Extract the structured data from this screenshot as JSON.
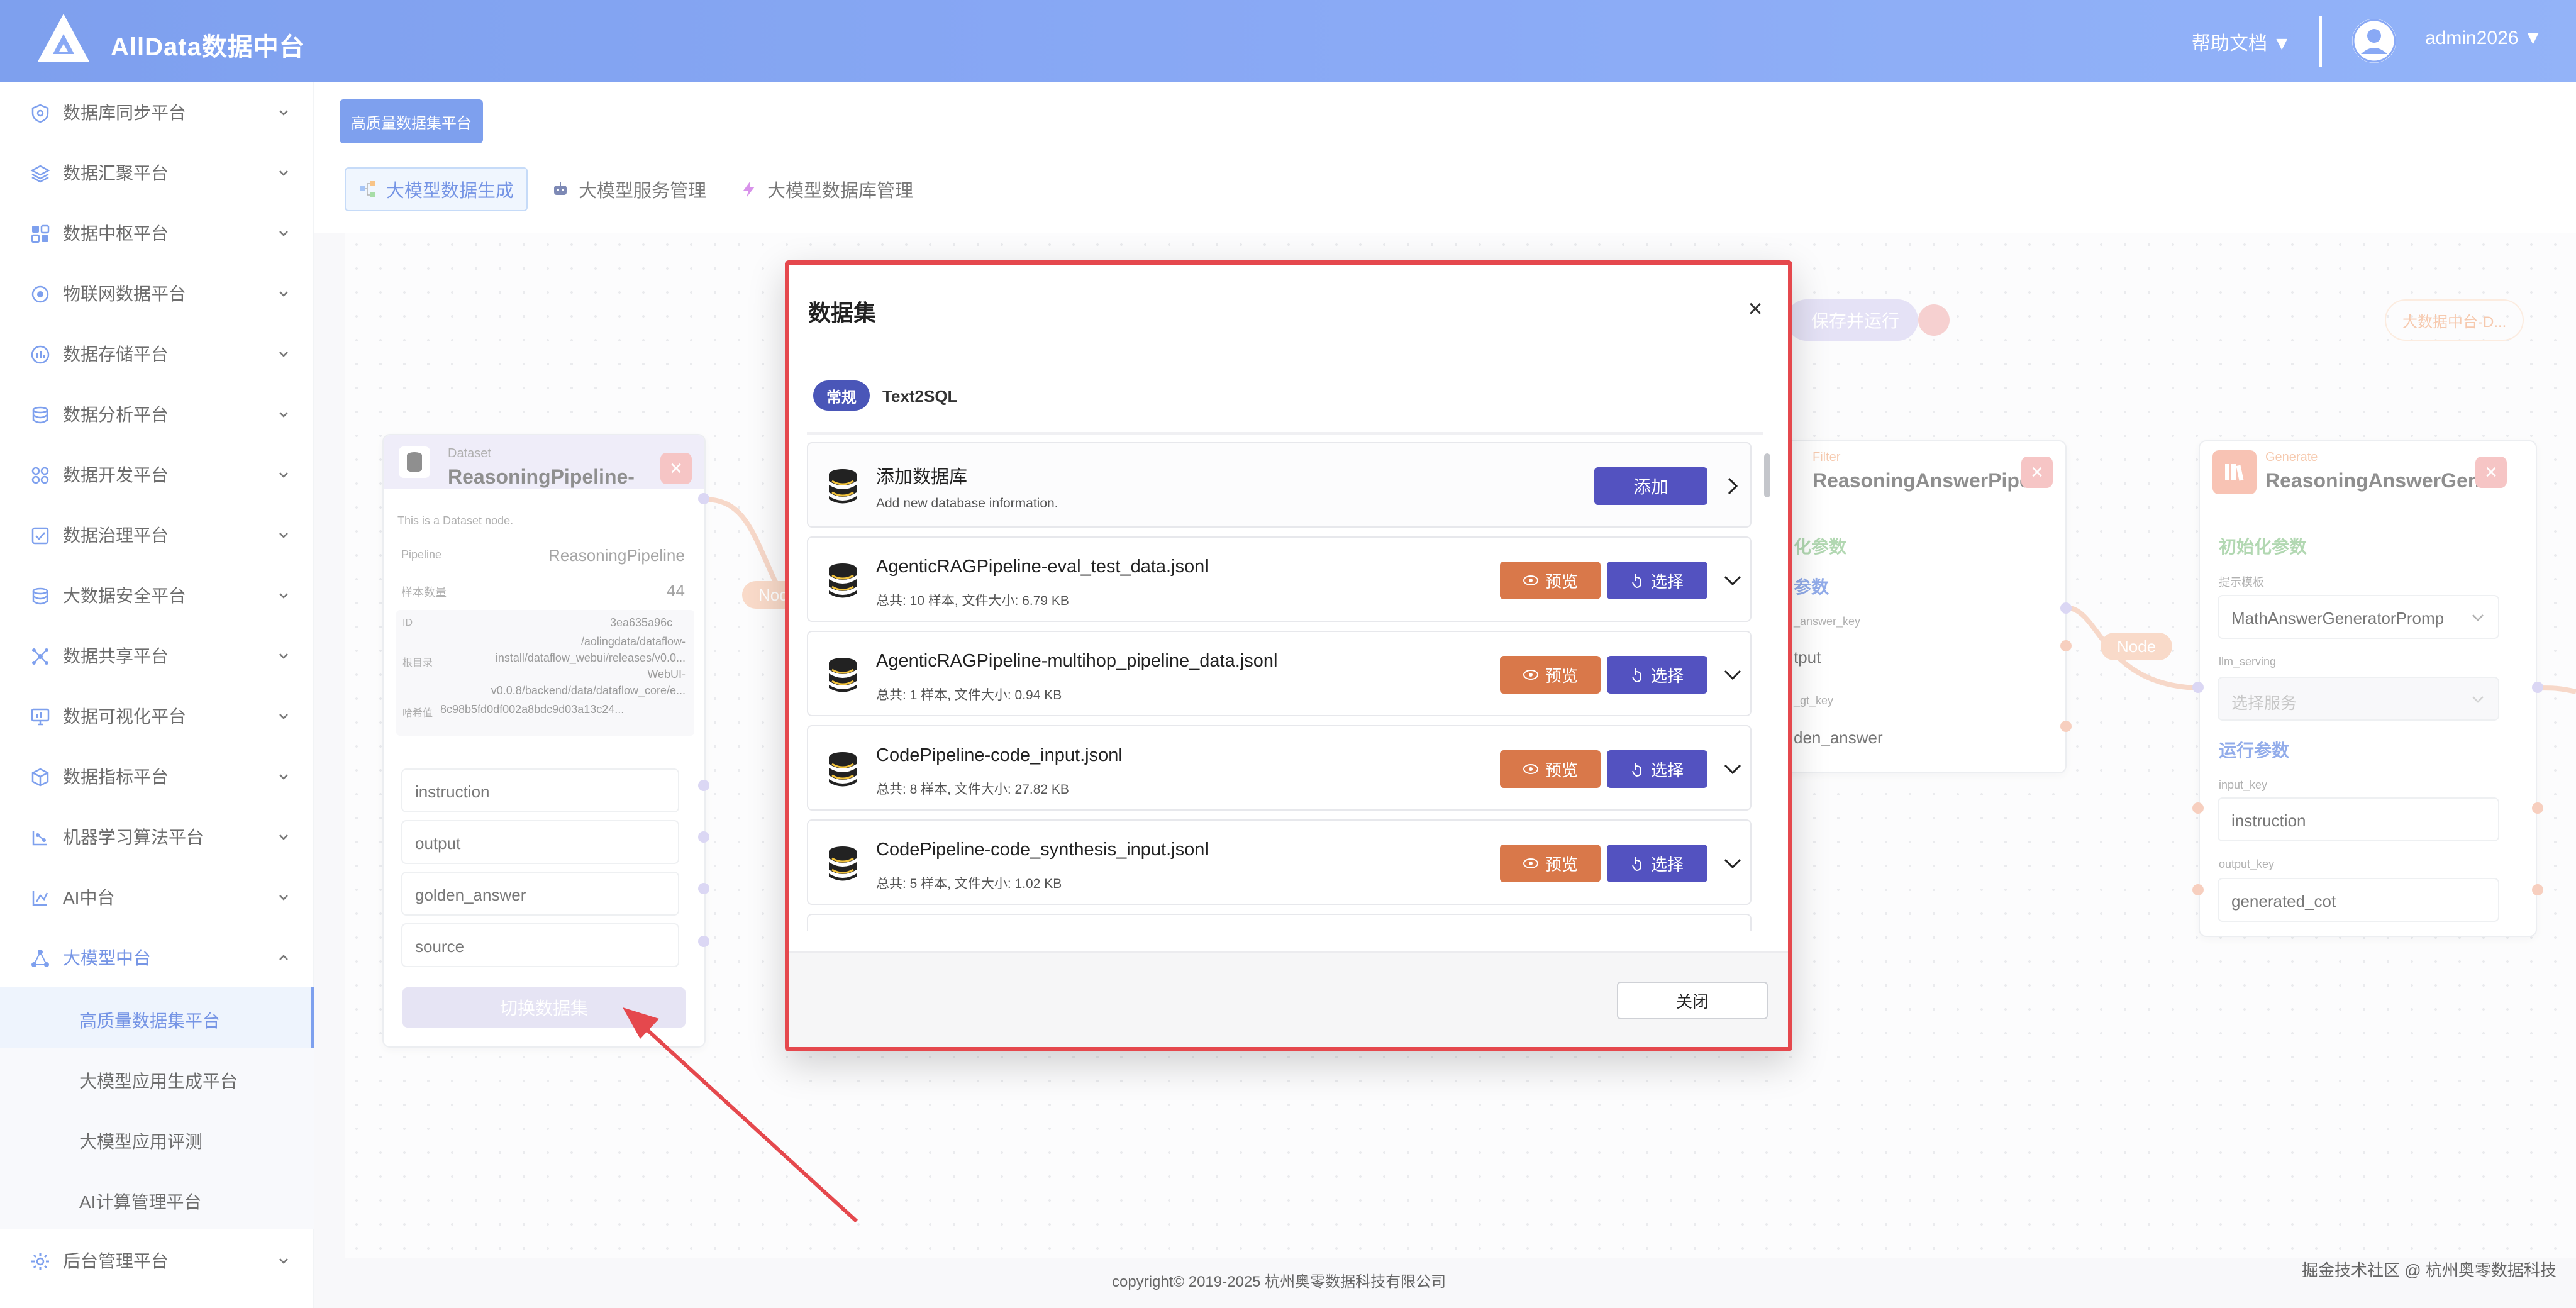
{
  "app": {
    "title": "AllData数据中台"
  },
  "topbar": {
    "help_label": "帮助文档 ▼",
    "user_label": "admin2026 ▼"
  },
  "sidebar": {
    "items": [
      {
        "label": "数据库同步平台"
      },
      {
        "label": "数据汇聚平台"
      },
      {
        "label": "数据中枢平台"
      },
      {
        "label": "物联网数据平台"
      },
      {
        "label": "数据存储平台"
      },
      {
        "label": "数据分析平台"
      },
      {
        "label": "数据开发平台"
      },
      {
        "label": "数据治理平台"
      },
      {
        "label": "大数据安全平台"
      },
      {
        "label": "数据共享平台"
      },
      {
        "label": "数据可视化平台"
      },
      {
        "label": "数据指标平台"
      },
      {
        "label": "机器学习算法平台"
      },
      {
        "label": "AI中台"
      },
      {
        "label": "大模型中台"
      }
    ],
    "sub_items": [
      {
        "label": "高质量数据集平台"
      },
      {
        "label": "大模型应用生成平台"
      },
      {
        "label": "大模型应用评测"
      },
      {
        "label": "AI计算管理平台"
      }
    ],
    "bottom_item": {
      "label": "后台管理平台"
    }
  },
  "content": {
    "breadcrumb_button": "高质量数据集平台",
    "tabs": [
      {
        "label": "大模型数据生成"
      },
      {
        "label": "大模型服务管理"
      },
      {
        "label": "大模型数据库管理"
      }
    ]
  },
  "canvas": {
    "save_run_label": "保存并运行",
    "badge_label": "大数据中台-D...",
    "edge_labels": [
      "Node",
      "Node"
    ],
    "dataset_node": {
      "type": "Dataset",
      "title": "ReasoningPipeline-pip...",
      "desc": "This is a Dataset node.",
      "pipeline_label": "Pipeline",
      "pipeline_value": "ReasoningPipeline",
      "sample_label": "样本数量",
      "sample_value": "44",
      "id_label": "ID",
      "id_value": "3ea635a96c",
      "dir_label": "根目录",
      "dir_value_lines": [
        "/aolingdata/dataflow-",
        "install/dataflow_webui/releases/v0.0...",
        "WebUI-",
        "v0.0.8/backend/data/dataflow_core/e..."
      ],
      "hash_label": "哈希值",
      "hash_value": "8c98b5fd0df002a8bdc9d03a13c24...",
      "fields": [
        "instruction",
        "output",
        "golden_answer",
        "source"
      ],
      "switch_label": "切换数据集"
    },
    "filter_node": {
      "type": "Filter",
      "title": "ReasoningAnswerPipe...",
      "init_label": "化参数",
      "run_label": "参数",
      "key1": "_answer_key",
      "val1": "tput",
      "key2": "_gt_key",
      "val2": "den_answer"
    },
    "generate_node": {
      "type": "Generate",
      "title": "ReasoningAnswerGen...",
      "init_label": "初始化参数",
      "template_label": "提示模板",
      "template_value": "MathAnswerGeneratorPromp",
      "llm_label": "llm_serving",
      "llm_placeholder": "选择服务",
      "run_label": "运行参数",
      "input_key_label": "input_key",
      "input_key_value": "instruction",
      "output_key_label": "output_key",
      "output_key_value": "generated_cot"
    }
  },
  "modal": {
    "title": "数据集",
    "tabs": [
      {
        "label": "常规"
      },
      {
        "label": "Text2SQL"
      }
    ],
    "add_row": {
      "name": "添加数据库",
      "sub": "Add new database information.",
      "button": "添加"
    },
    "preview_label": "预览",
    "select_label": "选择",
    "datasets": [
      {
        "name": "AgenticRAGPipeline-eval_test_data.jsonl",
        "meta": "总共: 10 样本, 文件大小: 6.79 KB"
      },
      {
        "name": "AgenticRAGPipeline-multihop_pipeline_data.jsonl",
        "meta": "总共: 1 样本, 文件大小: 0.94 KB"
      },
      {
        "name": "CodePipeline-code_input.jsonl",
        "meta": "总共: 8 样本, 文件大小: 27.82 KB"
      },
      {
        "name": "CodePipeline-code_synthesis_input.jsonl",
        "meta": "总共: 5 样本, 文件大小: 1.02 KB"
      }
    ],
    "close_label": "关闭"
  },
  "footer": {
    "copyright": "copyright© 2019-2025 杭州奥零数据科技有限公司",
    "watermark": "掘金技术社区 @ 杭州奥零数据科技"
  },
  "colors": {
    "topbar": "#4d7df0",
    "primary": "#3c6fe6",
    "modal_border": "#e5484d",
    "preview_button": "#d9784a",
    "select_button": "#5352c0",
    "annotation_arrow": "#e5484d"
  }
}
